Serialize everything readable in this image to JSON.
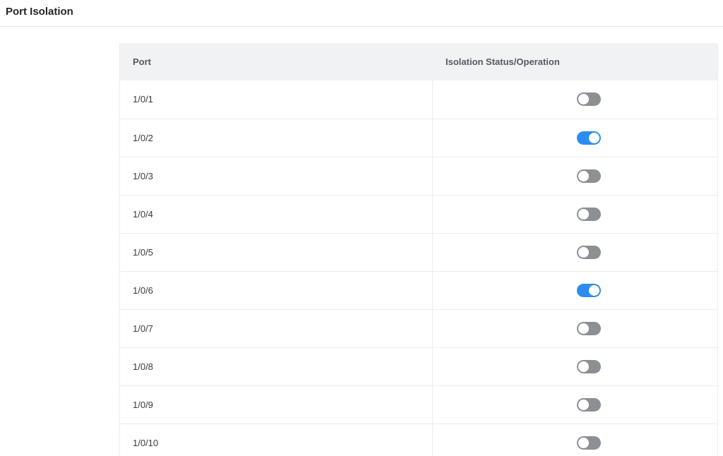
{
  "page": {
    "title": "Port Isolation"
  },
  "table": {
    "columns": [
      "Port",
      "Isolation Status/Operation"
    ],
    "rows": [
      {
        "port": "1/0/1",
        "isolated": false
      },
      {
        "port": "1/0/2",
        "isolated": true
      },
      {
        "port": "1/0/3",
        "isolated": false
      },
      {
        "port": "1/0/4",
        "isolated": false
      },
      {
        "port": "1/0/5",
        "isolated": false
      },
      {
        "port": "1/0/6",
        "isolated": true
      },
      {
        "port": "1/0/7",
        "isolated": false
      },
      {
        "port": "1/0/8",
        "isolated": false
      },
      {
        "port": "1/0/9",
        "isolated": false
      },
      {
        "port": "1/0/10",
        "isolated": false
      }
    ]
  },
  "colors": {
    "toggle_on": "#2d8cf0",
    "toggle_off": "#8c8f94",
    "header_bg": "#f0f2f4"
  }
}
